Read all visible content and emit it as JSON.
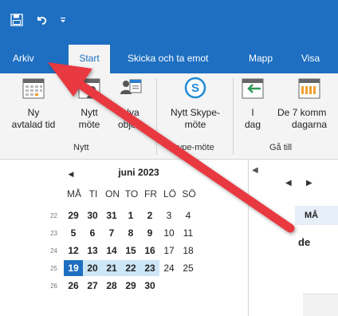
{
  "quick_access": {
    "save_icon": "save-icon",
    "undo_icon": "undo-icon",
    "more_icon": "customize-quick-access-icon"
  },
  "tabs": [
    {
      "label": "Arkiv"
    },
    {
      "label": "Start"
    },
    {
      "label": "Skicka och ta emot"
    },
    {
      "label": "Mapp"
    },
    {
      "label": "Visa"
    }
  ],
  "ribbon": {
    "new_appointment": {
      "line1": "Ny",
      "line2": "avtalad tid"
    },
    "new_meeting": {
      "line1": "Nytt",
      "line2": "möte"
    },
    "new_items": {
      "line1": "Nya",
      "line2": "objekt"
    },
    "group_new": "Nytt",
    "skype_meeting": {
      "line1": "Nytt Skype-",
      "line2": "möte"
    },
    "group_skype": "Skype-möte",
    "day": {
      "line1": "I",
      "line2": "dag"
    },
    "next7": {
      "line1": "De 7 komm",
      "line2": "dagarna"
    },
    "group_goto": "Gå till"
  },
  "calendar": {
    "month": "juni 2023",
    "weekdays": [
      "MÅ",
      "TI",
      "ON",
      "TO",
      "FR",
      "LÖ",
      "SÖ"
    ],
    "weeks": [
      {
        "num": "22",
        "days": [
          "29",
          "30",
          "31",
          "1",
          "2",
          "3",
          "4"
        ]
      },
      {
        "num": "23",
        "days": [
          "5",
          "6",
          "7",
          "8",
          "9",
          "10",
          "11"
        ]
      },
      {
        "num": "24",
        "days": [
          "12",
          "13",
          "14",
          "15",
          "16",
          "17",
          "18"
        ]
      },
      {
        "num": "25",
        "days": [
          "19",
          "20",
          "21",
          "22",
          "23",
          "24",
          "25"
        ]
      },
      {
        "num": "26",
        "days": [
          "26",
          "27",
          "28",
          "29",
          "30"
        ]
      }
    ],
    "today": "19"
  },
  "dayview": {
    "header": "MÅ",
    "text": "de"
  },
  "colors": {
    "accent": "#1e6fc1",
    "ribbon_bg": "#f4f4f4",
    "arrow": "#e8393f",
    "selection": "#cde6f7"
  }
}
